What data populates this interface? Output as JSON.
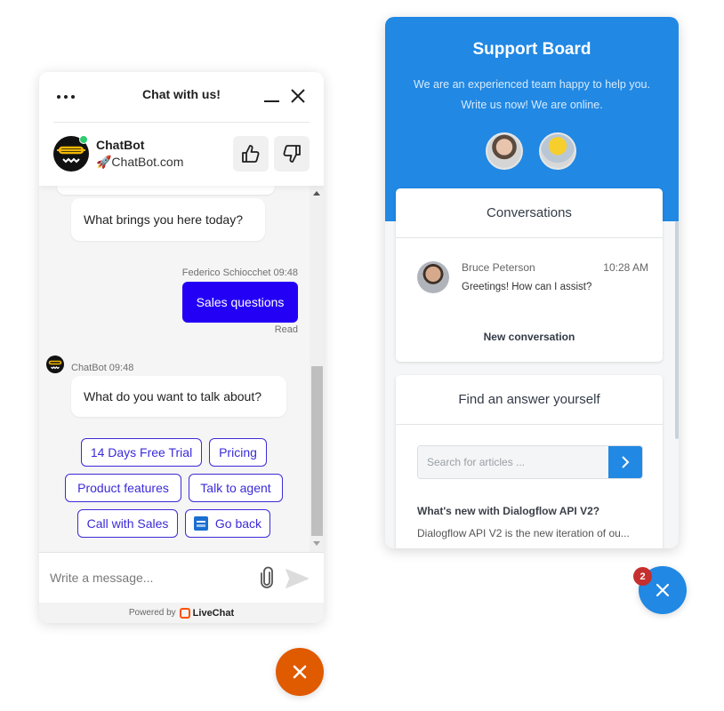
{
  "livechat": {
    "header": {
      "title": "Chat with us!",
      "more_icon": "more-dots-icon",
      "minimize_icon": "minimize-icon",
      "close_icon": "close-icon"
    },
    "agent": {
      "name": "ChatBot",
      "subtitle": "🚀ChatBot.com",
      "status": "online",
      "status_color": "#2ecc71",
      "rate_up_icon": "thumbs-up-icon",
      "rate_down_icon": "thumbs-down-icon"
    },
    "messages": [
      {
        "from": "bot",
        "text": "What brings you here today?"
      },
      {
        "from": "user",
        "meta": "Federico Schiocchet 09:48",
        "text": "Sales questions",
        "status": "Read"
      },
      {
        "from": "bot",
        "meta": "ChatBot 09:48",
        "text": "What do you want to talk about?"
      }
    ],
    "quick_replies": [
      {
        "label": "14 Days Free Trial"
      },
      {
        "label": "Pricing"
      },
      {
        "label": "Product features"
      },
      {
        "label": "Talk to agent"
      },
      {
        "label": "Call with Sales"
      },
      {
        "label": "Go back",
        "icon": "back-icon"
      }
    ],
    "composer": {
      "placeholder": "Write a message...",
      "value": "",
      "attach_icon": "paperclip-icon",
      "send_icon": "send-icon"
    },
    "footer": {
      "powered_by": "Powered by",
      "brand": "LiveChat"
    },
    "colors": {
      "accent": "#2300f5",
      "quick_reply": "#3b2bd8",
      "fab": "#e05a00"
    }
  },
  "supportboard": {
    "header": {
      "title": "Support Board",
      "subtitle_line1": "We are an experienced team happy to help you.",
      "subtitle_line2": "Write us now! We are online."
    },
    "conversations": {
      "title": "Conversations",
      "items": [
        {
          "name": "Bruce Peterson",
          "time": "10:28 AM",
          "message": "Greetings! How can I assist?"
        }
      ],
      "new_conversation_label": "New conversation"
    },
    "articles": {
      "title": "Find an answer yourself",
      "search_placeholder": "Search for articles ...",
      "search_value": "",
      "items": [
        {
          "title": "What's new with Dialogflow API V2?",
          "excerpt": "Dialogflow API V2 is the new iteration of ou..."
        }
      ]
    },
    "fab": {
      "badge_count": "2",
      "icon": "close-icon"
    },
    "colors": {
      "primary": "#2188e3",
      "badge": "#c62f2f"
    }
  }
}
